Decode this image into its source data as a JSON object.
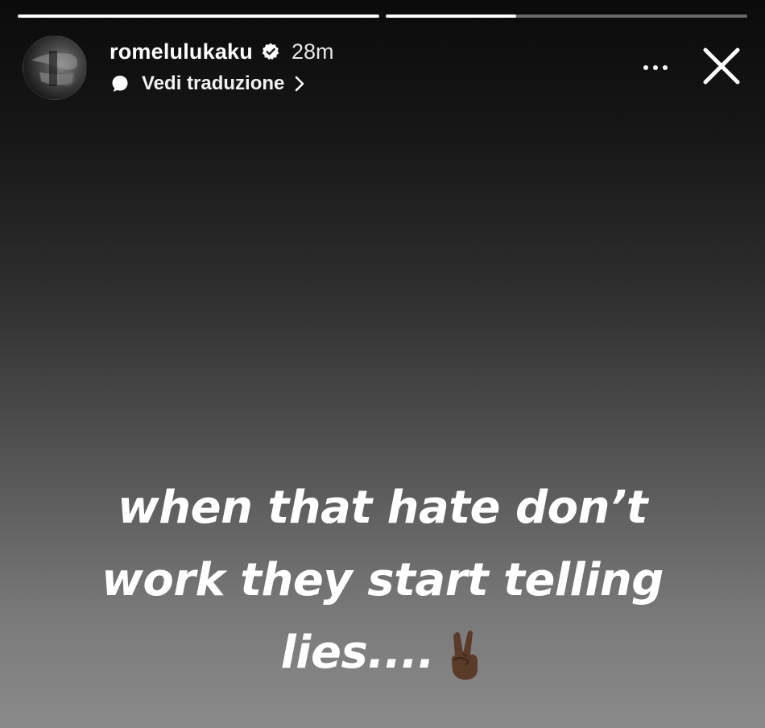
{
  "story": {
    "progress": [
      1.0,
      0.36
    ],
    "author": {
      "username": "romelulukaku",
      "verified": true,
      "time": "28m"
    },
    "translate_label": "Vedi traduzione",
    "text_lines": [
      "when that hate don’t",
      "work they start telling",
      "lies...."
    ],
    "emoji": "victory-hand-dark-skin-tone"
  },
  "icons": {
    "verified": "verified-badge-icon",
    "translate": "speech-bubble-icon",
    "chevron": "chevron-right-icon",
    "more": "more-options-icon",
    "close": "close-icon"
  },
  "colors": {
    "text": "#ffffff",
    "background_top": "#0b0b0b",
    "background_bottom": "#8a8a8a",
    "emoji_skin": "#5a3a28"
  }
}
